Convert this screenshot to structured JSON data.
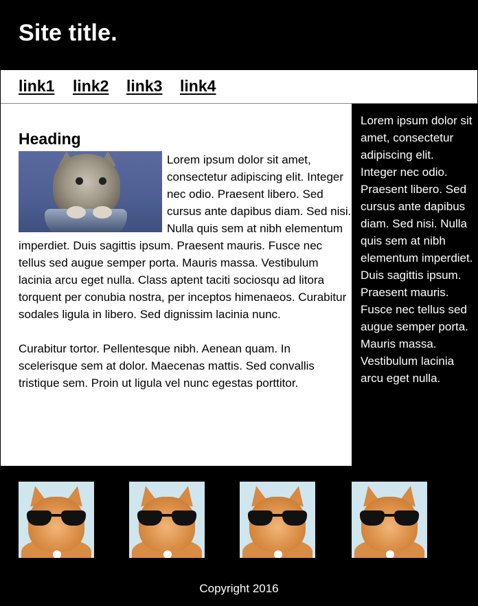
{
  "header": {
    "title": "Site title."
  },
  "nav": {
    "links": [
      "link1",
      "link2",
      "link3",
      "link4"
    ]
  },
  "main": {
    "heading": "Heading",
    "paragraphs": [
      "Lorem ipsum dolor sit amet, consectetur adipiscing elit. Integer nec odio. Praesent libero. Sed cursus ante dapibus diam. Sed nisi. Nulla quis sem at nibh elementum imperdiet. Duis sagittis ipsum. Praesent mauris. Fusce nec tellus sed augue semper porta. Mauris massa. Vestibulum lacinia arcu eget nulla. Class aptent taciti sociosqu ad litora torquent per conubia nostra, per inceptos himenaeos. Curabitur sodales ligula in libero. Sed dignissim lacinia nunc.",
      "Curabitur tortor. Pellentesque nibh. Aenean quam. In scelerisque sem at dolor. Maecenas mattis. Sed convallis tristique sem. Proin ut ligula vel nunc egestas porttitor."
    ]
  },
  "aside": {
    "text": "Lorem ipsum dolor sit amet, consectetur adipiscing elit. Integer nec odio. Praesent libero. Sed cursus ante dapibus diam. Sed nisi. Nulla quis sem at nibh elementum imperdiet. Duis sagittis ipsum. Praesent mauris. Fusce nec tellus sed augue semper porta. Mauris massa. Vestibulum lacinia arcu eget nulla."
  },
  "footer": {
    "copyright": "Copyright 2016"
  },
  "colors": {
    "header_bg": "#000000",
    "page_bg": "#ffffff",
    "text": "#000000",
    "inverse_text": "#ffffff"
  },
  "icons": {
    "kitten_image": "kitten-photo",
    "footer_images": [
      "cool-cat-photo",
      "cool-cat-photo",
      "cool-cat-photo",
      "cool-cat-photo"
    ]
  }
}
